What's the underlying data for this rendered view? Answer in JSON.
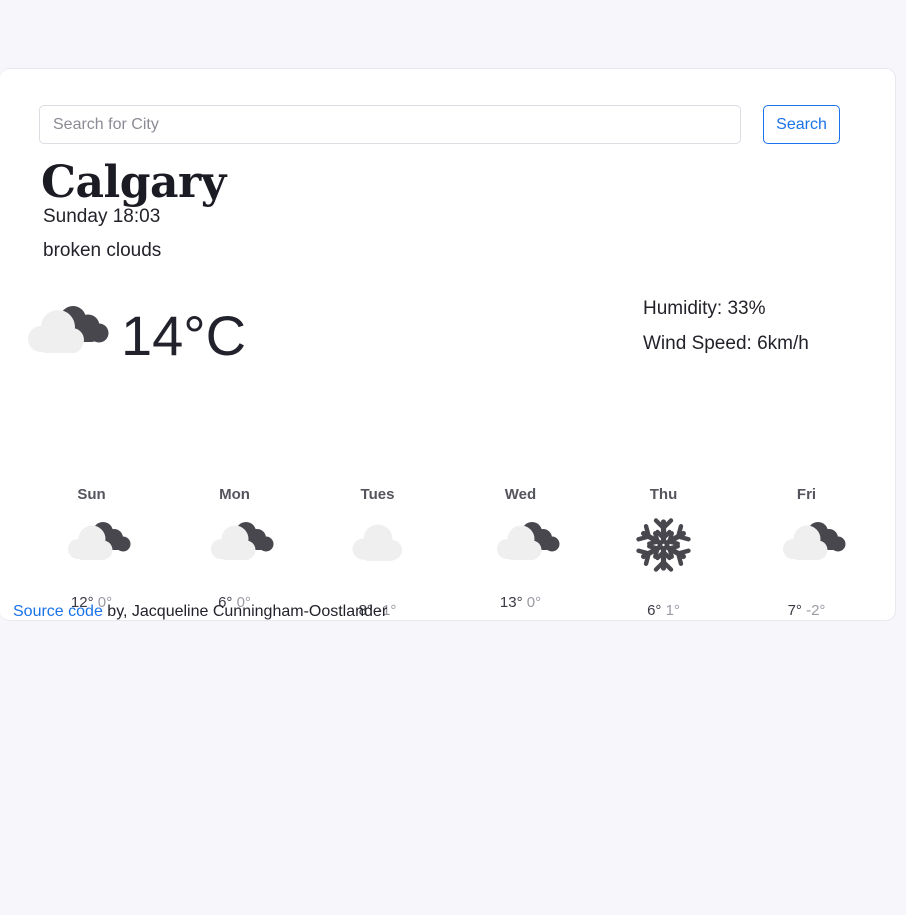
{
  "theme": {
    "page_background": "#f6f6fb",
    "card_background": "#ffffff",
    "accent": "#1a73e8",
    "cloud_light": "#efeff0",
    "cloud_dark": "#47474d",
    "text_primary": "#22222a",
    "text_muted": "#9a9aa4"
  },
  "search": {
    "placeholder": "Search for City",
    "value": "",
    "button_label": "Search"
  },
  "current": {
    "city": "Calgary",
    "datetime": "Sunday 18:03",
    "description": "broken clouds",
    "temperature": "14°C",
    "icon": "broken-clouds-icon",
    "humidity_label": "Humidity: 33%",
    "wind_label": "Wind Speed: 6km/h"
  },
  "forecast": {
    "days": [
      {
        "day": "Sun",
        "icon": "broken-clouds-icon",
        "high": "12°",
        "low": "0°"
      },
      {
        "day": "Mon",
        "icon": "broken-clouds-icon",
        "high": "6°",
        "low": "0°"
      },
      {
        "day": "Tues",
        "icon": "overcast-clouds-icon",
        "high": "8°",
        "low": "-1°"
      },
      {
        "day": "Wed",
        "icon": "broken-clouds-icon",
        "high": "13°",
        "low": "0°"
      },
      {
        "day": "Thu",
        "icon": "snowflake-icon",
        "high": "6°",
        "low": "1°"
      },
      {
        "day": "Fri",
        "icon": "broken-clouds-icon",
        "high": "7°",
        "low": "-2°"
      }
    ]
  },
  "footer": {
    "link_label": "Source code",
    "credit_text": " by, Jacqueline Cunningham-Oostlander"
  }
}
